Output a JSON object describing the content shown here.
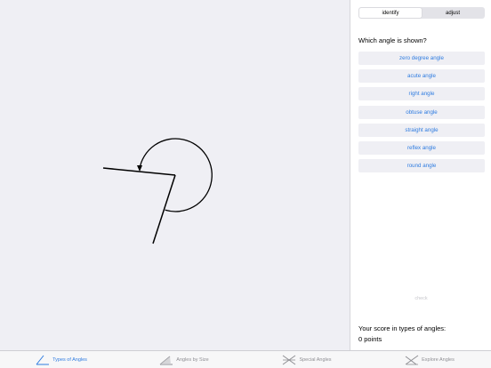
{
  "segment": {
    "identify_label": "identify",
    "adjust_label": "adjust",
    "selected": "identify"
  },
  "question": "Which angle is shown?",
  "options": [
    "zero degree angle",
    "acute angle",
    "right angle",
    "obtuse angle",
    "straight angle",
    "reflex angle",
    "round angle"
  ],
  "check_label": "check",
  "score": {
    "label": "Your score in types of angles:",
    "value": "0 points"
  },
  "tabs": [
    {
      "label": "Types of Angles",
      "icon": "types-of-angles-icon",
      "active": true
    },
    {
      "label": "Angles by Size",
      "icon": "angles-by-size-icon",
      "active": false
    },
    {
      "label": "Special Angles",
      "icon": "special-angles-icon",
      "active": false
    },
    {
      "label": "Explore Angles",
      "icon": "explore-angles-icon",
      "active": false
    }
  ],
  "colors": {
    "accent": "#2f7ce0",
    "inactive": "#8e8e93",
    "button_bg": "#efeff4"
  }
}
